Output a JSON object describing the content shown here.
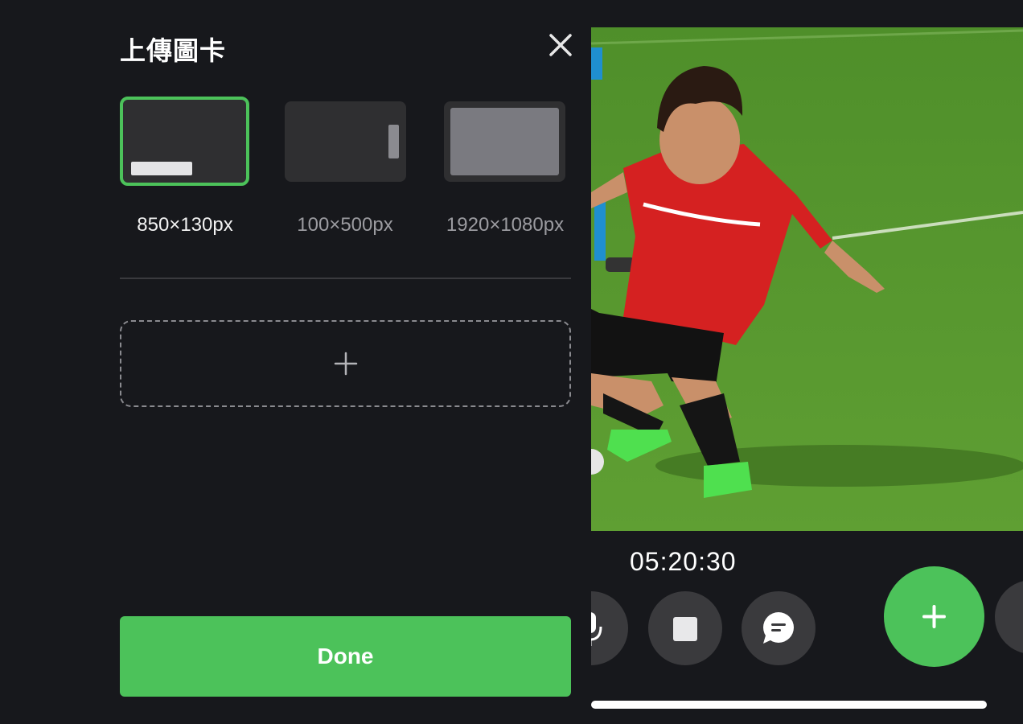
{
  "dialog": {
    "title": "上傳圖卡",
    "close_icon": "close-icon",
    "options": [
      {
        "label": "850×130px",
        "selected": true
      },
      {
        "label": "100×500px",
        "selected": false
      },
      {
        "label": "1920×1080px",
        "selected": false
      }
    ],
    "add_icon": "plus-icon",
    "done_label": "Done"
  },
  "stream": {
    "timer": "05:20:30",
    "controls": [
      "microphone-icon",
      "stop-icon",
      "chat-icon",
      "plus-icon"
    ],
    "accent": "#4cc25a"
  }
}
